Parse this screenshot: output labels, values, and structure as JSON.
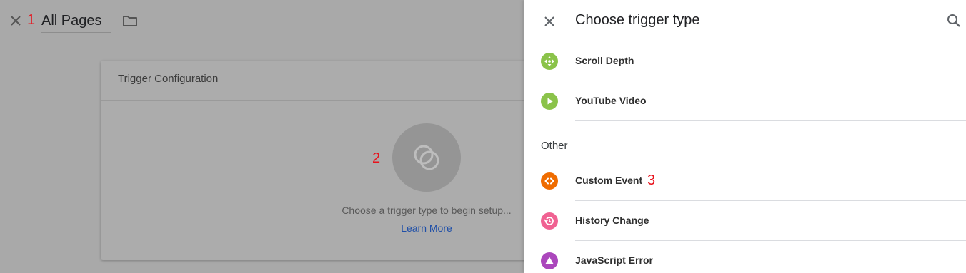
{
  "editor": {
    "trigger_name": "All Pages",
    "card_title": "Trigger Configuration",
    "empty_hint": "Choose a trigger type to begin setup...",
    "learn_more": "Learn More"
  },
  "annotations": {
    "one": "1",
    "two": "2",
    "three": "3"
  },
  "drawer": {
    "title": "Choose trigger type",
    "section_other": "Other",
    "items": [
      {
        "label": "Scroll Depth",
        "icon": "scroll-depth-icon",
        "color": "#8bc34a"
      },
      {
        "label": "YouTube Video",
        "icon": "play-icon",
        "color": "#8bc34a"
      },
      {
        "label": "Custom Event",
        "icon": "code-icon",
        "color": "#ef6c00"
      },
      {
        "label": "History Change",
        "icon": "history-icon",
        "color": "#f06292"
      },
      {
        "label": "JavaScript Error",
        "icon": "warning-icon",
        "color": "#ab47bc"
      }
    ]
  },
  "colors": {
    "annotation": "#e8121c",
    "link": "#1f4fa8",
    "overlay": "#a9a9a9"
  }
}
